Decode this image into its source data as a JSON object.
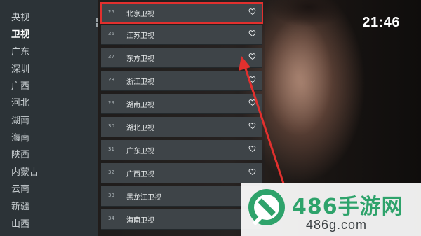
{
  "clock": "21:46",
  "provinces": [
    {
      "label": "央视",
      "active": false
    },
    {
      "label": "卫视",
      "active": true
    },
    {
      "label": "广东",
      "active": false
    },
    {
      "label": "深圳",
      "active": false
    },
    {
      "label": "广西",
      "active": false
    },
    {
      "label": "河北",
      "active": false
    },
    {
      "label": "湖南",
      "active": false
    },
    {
      "label": "海南",
      "active": false
    },
    {
      "label": "陕西",
      "active": false
    },
    {
      "label": "内蒙古",
      "active": false
    },
    {
      "label": "云南",
      "active": false
    },
    {
      "label": "新疆",
      "active": false
    },
    {
      "label": "山西",
      "active": false
    }
  ],
  "channels": [
    {
      "num": "25",
      "name": "北京卫视",
      "selected": true
    },
    {
      "num": "26",
      "name": "江苏卫视",
      "selected": false
    },
    {
      "num": "27",
      "name": "东方卫视",
      "selected": false
    },
    {
      "num": "28",
      "name": "浙江卫视",
      "selected": false
    },
    {
      "num": "29",
      "name": "湖南卫视",
      "selected": false
    },
    {
      "num": "30",
      "name": "湖北卫视",
      "selected": false
    },
    {
      "num": "31",
      "name": "广东卫视",
      "selected": false
    },
    {
      "num": "32",
      "name": "广西卫视",
      "selected": false
    },
    {
      "num": "33",
      "name": "黑龙江卫视",
      "selected": false
    },
    {
      "num": "34",
      "name": "海南卫视",
      "selected": false
    }
  ],
  "watermark": {
    "title": "486手游网",
    "url": "486g.com"
  },
  "colors": {
    "highlight": "#e2302e",
    "watermark_green": "#2ea36b"
  }
}
